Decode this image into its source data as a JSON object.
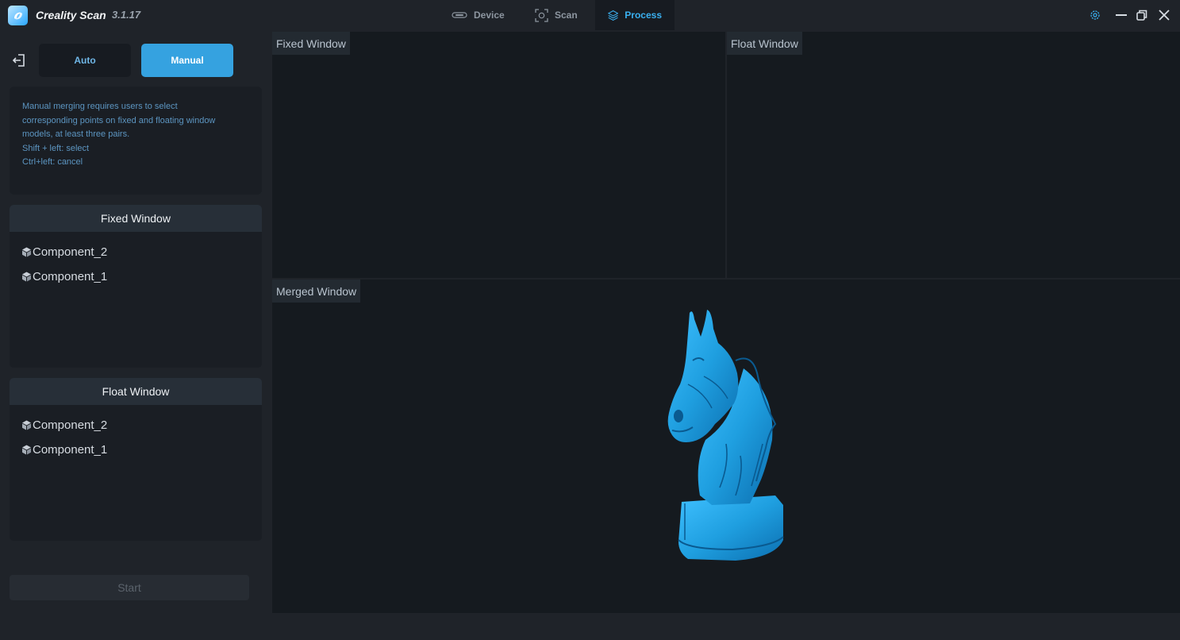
{
  "app": {
    "name": "Creality Scan",
    "version": "3.1.17"
  },
  "nav": {
    "tabs": [
      {
        "label": "Device",
        "icon": "device-icon",
        "active": false
      },
      {
        "label": "Scan",
        "icon": "scan-icon",
        "active": false
      },
      {
        "label": "Process",
        "icon": "layers-icon",
        "active": true
      }
    ]
  },
  "window_controls": [
    "settings-icon",
    "minimize-icon",
    "restore-icon",
    "close-icon"
  ],
  "mode": {
    "auto_label": "Auto",
    "manual_label": "Manual",
    "selected": "Manual"
  },
  "help": {
    "lines": [
      "Manual merging requires users to select",
      "corresponding points on fixed and floating window",
      "models, at least three pairs.",
      "Shift + left: select",
      "Ctrl+left: cancel"
    ]
  },
  "fixed_list": {
    "title": "Fixed Window",
    "items": [
      "Component_2",
      "Component_1"
    ]
  },
  "float_list": {
    "title": "Float Window",
    "items": [
      "Component_2",
      "Component_1"
    ]
  },
  "start_label": "Start",
  "viewports": {
    "fixed_label": "Fixed Window",
    "float_label": "Float Window",
    "merged_label": "Merged Window"
  },
  "colors": {
    "accent": "#35a2e0",
    "model": "#1f9fe0",
    "background": "#151a1f"
  }
}
